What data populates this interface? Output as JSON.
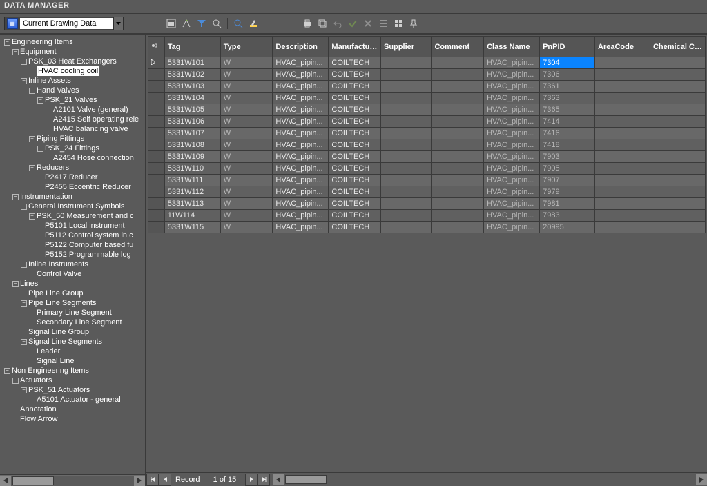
{
  "title": "DATA MANAGER",
  "toolbar": {
    "combo_label": "Current Drawing Data"
  },
  "tree": {
    "rows": [
      {
        "indent": 0,
        "pm": "-",
        "label": "Engineering Items"
      },
      {
        "indent": 1,
        "pm": "-",
        "label": "Equipment"
      },
      {
        "indent": 2,
        "pm": "-",
        "label": "PSK_03 Heat Exchangers"
      },
      {
        "indent": 3,
        "pm": "",
        "label": "HVAC cooling coil",
        "selected": true
      },
      {
        "indent": 2,
        "pm": "-",
        "label": "Inline Assets"
      },
      {
        "indent": 3,
        "pm": "-",
        "label": "Hand Valves"
      },
      {
        "indent": 4,
        "pm": "-",
        "label": "PSK_21 Valves"
      },
      {
        "indent": 5,
        "pm": "",
        "label": "A2101 Valve (general)"
      },
      {
        "indent": 5,
        "pm": "",
        "label": "A2415 Self operating rele"
      },
      {
        "indent": 5,
        "pm": "",
        "label": "HVAC balancing valve"
      },
      {
        "indent": 3,
        "pm": "-",
        "label": "Piping Fittings"
      },
      {
        "indent": 4,
        "pm": "-",
        "label": "PSK_24 Fittings"
      },
      {
        "indent": 5,
        "pm": "",
        "label": "A2454 Hose connection"
      },
      {
        "indent": 3,
        "pm": "-",
        "label": "Reducers"
      },
      {
        "indent": 4,
        "pm": "",
        "label": "P2417 Reducer"
      },
      {
        "indent": 4,
        "pm": "",
        "label": "P2455 Eccentric Reducer"
      },
      {
        "indent": 1,
        "pm": "-",
        "label": "Instrumentation"
      },
      {
        "indent": 2,
        "pm": "-",
        "label": "General Instrument Symbols"
      },
      {
        "indent": 3,
        "pm": "-",
        "label": "PSK_50 Measurement and c"
      },
      {
        "indent": 4,
        "pm": "",
        "label": "P5101 Local instrument"
      },
      {
        "indent": 4,
        "pm": "",
        "label": "P5112 Control system in c"
      },
      {
        "indent": 4,
        "pm": "",
        "label": "P5122 Computer based fu"
      },
      {
        "indent": 4,
        "pm": "",
        "label": "P5152 Programmable log"
      },
      {
        "indent": 2,
        "pm": "-",
        "label": "Inline Instruments"
      },
      {
        "indent": 3,
        "pm": "",
        "label": "Control Valve"
      },
      {
        "indent": 1,
        "pm": "-",
        "label": "Lines"
      },
      {
        "indent": 2,
        "pm": "",
        "label": "Pipe Line Group"
      },
      {
        "indent": 2,
        "pm": "-",
        "label": "Pipe Line Segments"
      },
      {
        "indent": 3,
        "pm": "",
        "label": "Primary Line Segment"
      },
      {
        "indent": 3,
        "pm": "",
        "label": "Secondary Line Segment"
      },
      {
        "indent": 2,
        "pm": "",
        "label": "Signal Line Group"
      },
      {
        "indent": 2,
        "pm": "-",
        "label": "Signal Line Segments"
      },
      {
        "indent": 3,
        "pm": "",
        "label": "Leader"
      },
      {
        "indent": 3,
        "pm": "",
        "label": "Signal Line"
      },
      {
        "indent": 0,
        "pm": "-",
        "label": "Non Engineering Items"
      },
      {
        "indent": 1,
        "pm": "-",
        "label": "Actuators"
      },
      {
        "indent": 2,
        "pm": "-",
        "label": "PSK_51 Actuators"
      },
      {
        "indent": 3,
        "pm": "",
        "label": "A5101 Actuator - general"
      },
      {
        "indent": 1,
        "pm": "",
        "label": "Annotation"
      },
      {
        "indent": 1,
        "pm": "",
        "label": "Flow Arrow"
      }
    ]
  },
  "grid": {
    "columns": [
      "Tag",
      "Type",
      "Description",
      "Manufacturer",
      "Supplier",
      "Comment",
      "Class Name",
      "PnPID",
      "AreaCode",
      "Chemical Class"
    ],
    "rows": [
      {
        "tag": "5331W101",
        "type": "W",
        "desc": "HVAC_pipin...",
        "manu": "COILTECH",
        "class": "HVAC_pipin...",
        "pnpid": "7304",
        "hl": true,
        "ind": true
      },
      {
        "tag": "5331W102",
        "type": "W",
        "desc": "HVAC_pipin...",
        "manu": "COILTECH",
        "class": "HVAC_pipin...",
        "pnpid": "7306"
      },
      {
        "tag": "5331W103",
        "type": "W",
        "desc": "HVAC_pipin...",
        "manu": "COILTECH",
        "class": "HVAC_pipin...",
        "pnpid": "7361"
      },
      {
        "tag": "5331W104",
        "type": "W",
        "desc": "HVAC_pipin...",
        "manu": "COILTECH",
        "class": "HVAC_pipin...",
        "pnpid": "7363"
      },
      {
        "tag": "5331W105",
        "type": "W",
        "desc": "HVAC_pipin...",
        "manu": "COILTECH",
        "class": "HVAC_pipin...",
        "pnpid": "7365"
      },
      {
        "tag": "5331W106",
        "type": "W",
        "desc": "HVAC_pipin...",
        "manu": "COILTECH",
        "class": "HVAC_pipin...",
        "pnpid": "7414"
      },
      {
        "tag": "5331W107",
        "type": "W",
        "desc": "HVAC_pipin...",
        "manu": "COILTECH",
        "class": "HVAC_pipin...",
        "pnpid": "7416"
      },
      {
        "tag": "5331W108",
        "type": "W",
        "desc": "HVAC_pipin...",
        "manu": "COILTECH",
        "class": "HVAC_pipin...",
        "pnpid": "7418"
      },
      {
        "tag": "5331W109",
        "type": "W",
        "desc": "HVAC_pipin...",
        "manu": "COILTECH",
        "class": "HVAC_pipin...",
        "pnpid": "7903"
      },
      {
        "tag": "5331W110",
        "type": "W",
        "desc": "HVAC_pipin...",
        "manu": "COILTECH",
        "class": "HVAC_pipin...",
        "pnpid": "7905"
      },
      {
        "tag": "5331W111",
        "type": "W",
        "desc": "HVAC_pipin...",
        "manu": "COILTECH",
        "class": "HVAC_pipin...",
        "pnpid": "7907"
      },
      {
        "tag": "5331W112",
        "type": "W",
        "desc": "HVAC_pipin...",
        "manu": "COILTECH",
        "class": "HVAC_pipin...",
        "pnpid": "7979"
      },
      {
        "tag": "5331W113",
        "type": "W",
        "desc": "HVAC_pipin...",
        "manu": "COILTECH",
        "class": "HVAC_pipin...",
        "pnpid": "7981"
      },
      {
        "tag": "11W114",
        "type": "W",
        "desc": "HVAC_pipin...",
        "manu": "COILTECH",
        "class": "HVAC_pipin...",
        "pnpid": "7983"
      },
      {
        "tag": "5331W115",
        "type": "W",
        "desc": "HVAC_pipin...",
        "manu": "COILTECH",
        "class": "HVAC_pipin...",
        "pnpid": "20995"
      }
    ]
  },
  "nav": {
    "label": "Record",
    "position": "1 of 15"
  }
}
